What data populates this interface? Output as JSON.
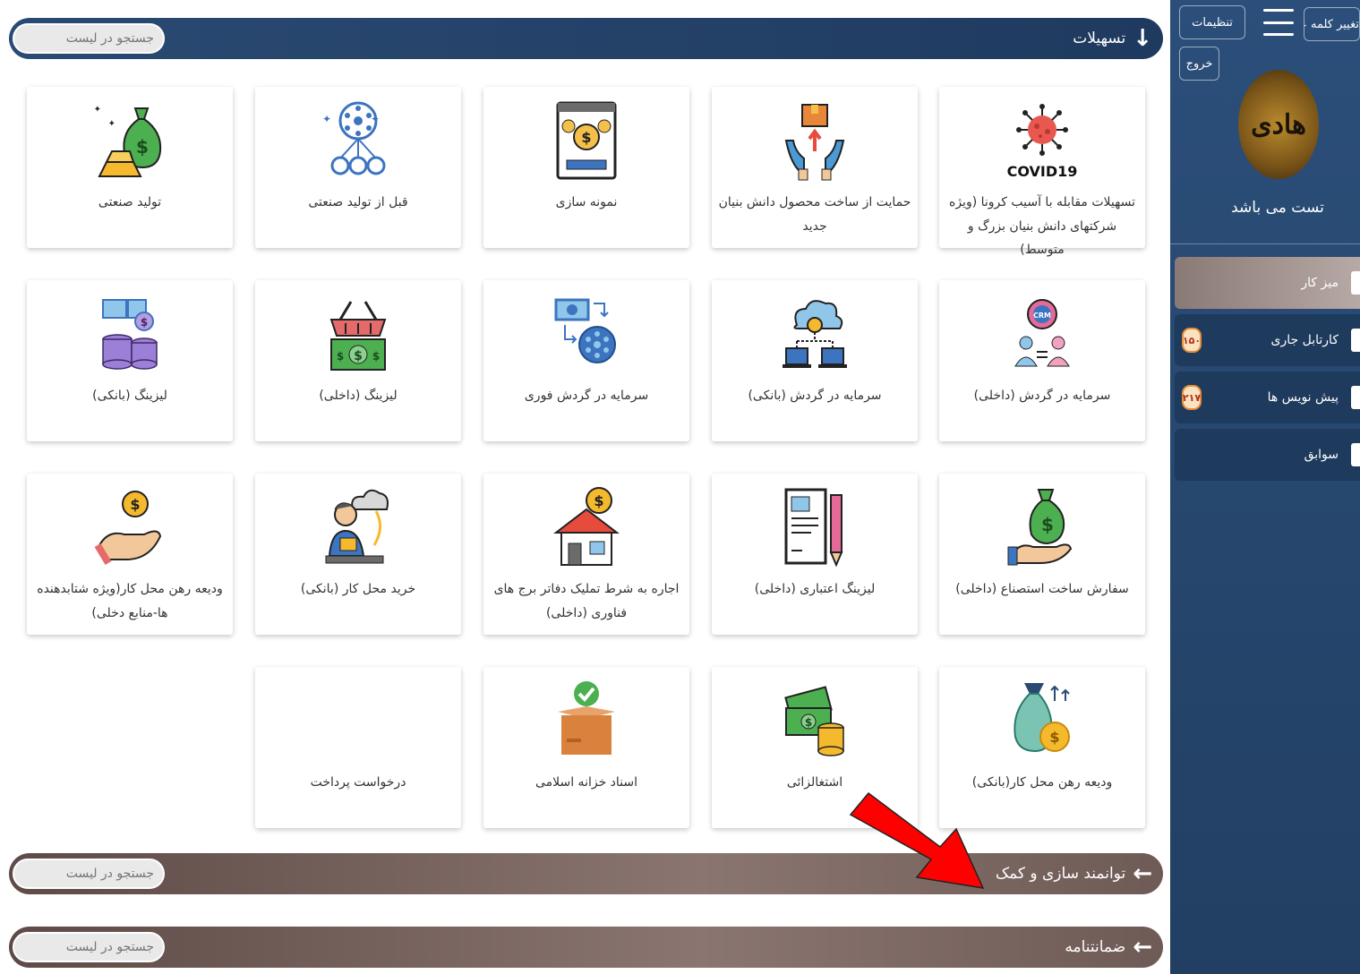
{
  "sections": {
    "facilities": {
      "title": "تسهیلات",
      "search_placeholder": "جستجو در لیست"
    },
    "empowerment": {
      "title": "توانمند سازی و کمک",
      "search_placeholder": "جستجو در لیست"
    },
    "guarantee": {
      "title": "ضمانتنامه",
      "search_placeholder": "جستجو در لیست"
    }
  },
  "cards": [
    {
      "label": "تسهیلات مقابله با آسیب کرونا (ویژه شرکتهای دانش بنیان بزرگ و متوسط)",
      "icon": "covid19-icon"
    },
    {
      "label": "حمایت از ساخت محصول دانش بنیان جدید",
      "icon": "product-hands-icon"
    },
    {
      "label": "نمونه سازی",
      "icon": "prototype-screen-icon"
    },
    {
      "label": "قبل از تولید صنعتی",
      "icon": "network-icon"
    },
    {
      "label": "تولید صنعتی",
      "icon": "money-bag-gold-icon"
    },
    {
      "label": "سرمایه در گردش (داخلی)",
      "icon": "crm-gear-icon"
    },
    {
      "label": "سرمایه در گردش (بانکی)",
      "icon": "cloud-network-icon"
    },
    {
      "label": "سرمایه در گردش فوری",
      "icon": "cash-flow-icon"
    },
    {
      "label": "لیزینگ (داخلی)",
      "icon": "basket-cash-icon"
    },
    {
      "label": "لیزینگ (بانکی)",
      "icon": "coins-stack-icon"
    },
    {
      "label": "سفارش ساخت استصناع (داخلی)",
      "icon": "hand-money-bag-icon"
    },
    {
      "label": "لیزینگ اعتباری (داخلی)",
      "icon": "document-pencil-icon"
    },
    {
      "label": "اجاره به شرط تملیک دفاتر برج های فناوری (داخلی)",
      "icon": "house-coin-icon"
    },
    {
      "label": "خرید محل کار (بانکی)",
      "icon": "worker-cloud-icon"
    },
    {
      "label": "ودیعه رهن محل کار(ویژه شتابدهنده ها-منابع دخلی)",
      "icon": "hand-coin-icon"
    },
    {
      "label": "ودیعه رهن محل کار(بانکی)",
      "icon": "money-bag-coin-icon"
    },
    {
      "label": "اشتغالزائی",
      "icon": "cash-coins-icon"
    },
    {
      "label": "اسناد خزانه اسلامی",
      "icon": "box-check-icon"
    },
    {
      "label": "درخواست پرداخت",
      "icon": ""
    }
  ],
  "sidebar": {
    "settings_label": "تنظیمات",
    "change_password_label": "تغییر کلمه عبور",
    "logout_label": "خروج",
    "user_name": "تست می باشد",
    "logo_text": "هادی",
    "nav": [
      {
        "label": "میز کار",
        "badge": ""
      },
      {
        "label": "کارتابل جاری",
        "badge": "۱۵۰"
      },
      {
        "label": "پیش نویس ها",
        "badge": "۲۱۷"
      },
      {
        "label": "سوابق",
        "badge": ""
      }
    ]
  },
  "colors": {
    "header_blue": "#1f3a5f",
    "header_taupe": "#7d6a66",
    "sidebar": "#24436a",
    "badge_border": "#e58f3a"
  }
}
